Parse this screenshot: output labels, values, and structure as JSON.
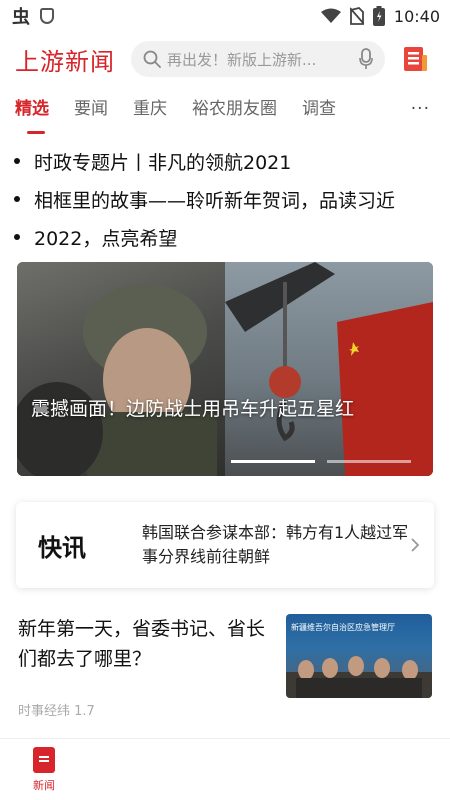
{
  "status_bar": {
    "app_glyph": "虫",
    "time": "10:40"
  },
  "header": {
    "app_title": "上游新闻",
    "search_placeholder": "再出发！新版上游新..."
  },
  "tabs": {
    "items": [
      "精选",
      "要闻",
      "重庆",
      "裕农朋友圈",
      "调查"
    ],
    "active_index": 0,
    "more_label": "···"
  },
  "headlines": [
    "时政专题片丨非凡的领航2021",
    "相框里的故事——聆听新年贺词，品读习近",
    "2022，点亮希望"
  ],
  "hero": {
    "caption": "震撼画面！边防战士用吊车升起五星红",
    "active_slide": 1,
    "slides": 2
  },
  "flash": {
    "label": "快讯",
    "text": "韩国联合参谋本部：韩方有1人越过军事分界线前往朝鲜"
  },
  "news_item": {
    "title": "新年第一天，省委书记、省长们都去了哪里？",
    "meta": "时事经纬 1.7",
    "thumb_caption": "新疆维吾尔自治区应急管理厅"
  },
  "bottom_nav": {
    "items": [
      {
        "label": "新闻",
        "active": true
      }
    ]
  },
  "colors": {
    "brand_red": "#d7262b"
  }
}
